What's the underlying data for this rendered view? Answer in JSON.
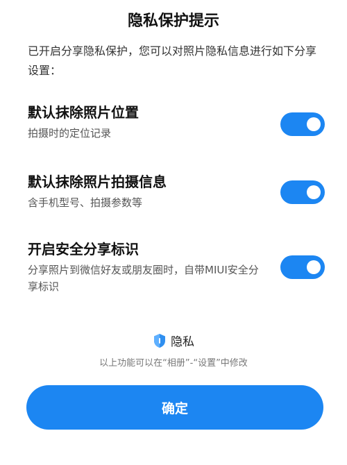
{
  "dialog": {
    "title": "隐私保护提示",
    "intro": "已开启分享隐私保护，您可以对照片隐私信息进行如下分享设置："
  },
  "settings": [
    {
      "title": "默认抹除照片位置",
      "description": "拍摄时的定位记录",
      "enabled": true
    },
    {
      "title": "默认抹除照片拍摄信息",
      "description": "含手机型号、拍摄参数等",
      "enabled": true
    },
    {
      "title": "开启安全分享标识",
      "description": "分享照片到微信好友或朋友圈时，自带MIUI安全分享标识",
      "enabled": true
    }
  ],
  "brand": {
    "icon": "privacy-shield-icon",
    "label": "隐私"
  },
  "footer": {
    "note": "以上功能可以在“相册”-“设置”中修改"
  },
  "actions": {
    "confirm_label": "确定"
  },
  "colors": {
    "accent": "#1c86f2",
    "background": "#ffffff"
  }
}
